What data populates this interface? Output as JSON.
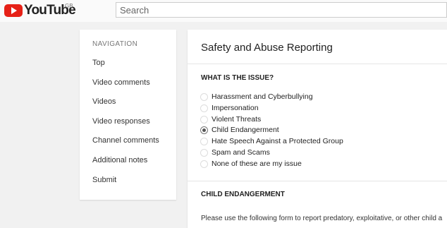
{
  "header": {
    "logo_text": "YouTube",
    "region": "GB",
    "search_placeholder": "Search",
    "brand_color": "#e62117"
  },
  "sidebar": {
    "heading": "NAVIGATION",
    "items": [
      {
        "label": "Top"
      },
      {
        "label": "Video comments"
      },
      {
        "label": "Videos"
      },
      {
        "label": "Video responses"
      },
      {
        "label": "Channel comments"
      },
      {
        "label": "Additional notes"
      },
      {
        "label": "Submit"
      }
    ]
  },
  "main": {
    "title": "Safety and Abuse Reporting",
    "question": "WHAT IS THE ISSUE?",
    "selected_option": "Child Endangerment",
    "options": [
      {
        "label": "Harassment and Cyberbullying"
      },
      {
        "label": "Impersonation"
      },
      {
        "label": "Violent Threats"
      },
      {
        "label": "Child Endangerment"
      },
      {
        "label": "Hate Speech Against a Protected Group"
      },
      {
        "label": "Spam and Scams"
      },
      {
        "label": "None of these are my issue"
      }
    ],
    "section_heading": "CHILD ENDANGERMENT",
    "description": "Please use the following form to report predatory, exploitative, or other child a"
  }
}
